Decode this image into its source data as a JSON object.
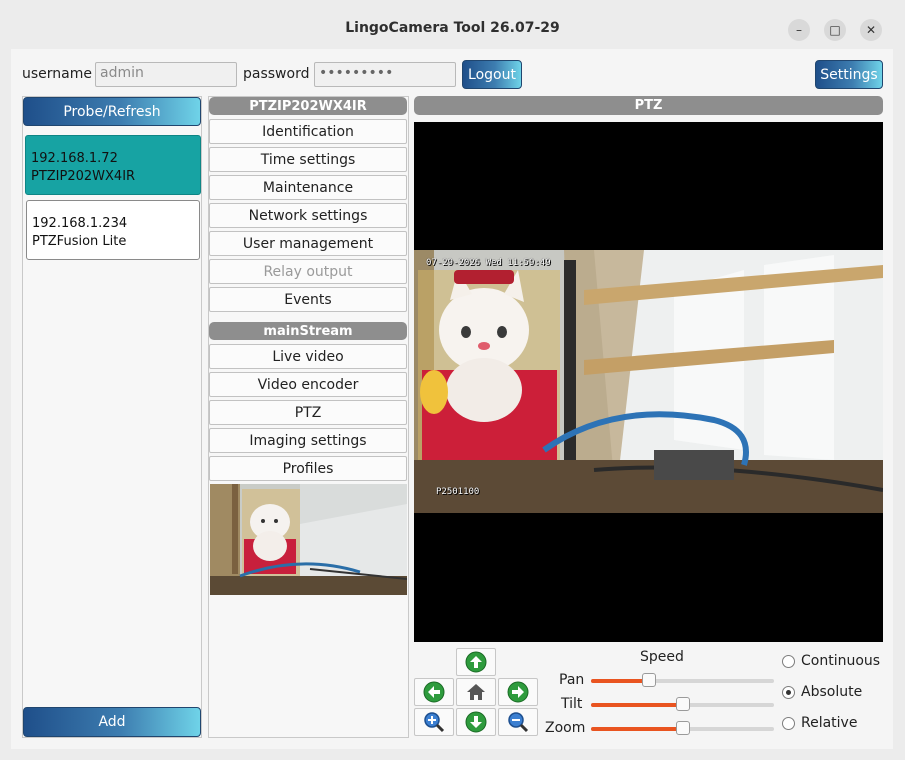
{
  "window": {
    "title": "LingoCamera Tool 26.07-29",
    "minimize_glyph": "–",
    "maximize_glyph": "□",
    "close_glyph": "✕"
  },
  "login": {
    "username_label": "username",
    "username_value": "admin",
    "password_label": "password",
    "password_value": "•••••••••",
    "logout_label": "Logout",
    "settings_label": "Settings"
  },
  "devices": {
    "probe_label": "Probe/Refresh",
    "add_label": "Add",
    "items": [
      {
        "ip": "192.168.1.72",
        "model": "PTZIP202WX4IR",
        "selected": true
      },
      {
        "ip": "192.168.1.234",
        "model": "PTZFusion Lite",
        "selected": false
      }
    ]
  },
  "menu": {
    "device_header": "PTZIP202WX4IR",
    "device_items": [
      {
        "label": "Identification",
        "enabled": true
      },
      {
        "label": "Time settings",
        "enabled": true
      },
      {
        "label": "Maintenance",
        "enabled": true
      },
      {
        "label": "Network settings",
        "enabled": true
      },
      {
        "label": "User management",
        "enabled": true
      },
      {
        "label": "Relay output",
        "enabled": false
      },
      {
        "label": "Events",
        "enabled": true
      }
    ],
    "stream_header": "mainStream",
    "stream_items": [
      {
        "label": "Live video",
        "enabled": true
      },
      {
        "label": "Video encoder",
        "enabled": true
      },
      {
        "label": "PTZ",
        "enabled": true
      },
      {
        "label": "Imaging settings",
        "enabled": true
      },
      {
        "label": "Profiles",
        "enabled": true
      }
    ]
  },
  "ptz": {
    "header": "PTZ",
    "osd_time": "07-29-2026 Wed 11:59:49",
    "osd_name": "P2501100",
    "speed_label": "Speed",
    "pan_label": "Pan",
    "tilt_label": "Tilt",
    "zoom_label": "Zoom",
    "pan_fraction": 0.3,
    "tilt_fraction": 0.5,
    "zoom_fraction": 0.5,
    "modes": [
      {
        "label": "Continuous",
        "checked": false
      },
      {
        "label": "Absolute",
        "checked": true
      },
      {
        "label": "Relative",
        "checked": false
      }
    ],
    "icons": [
      "up-arrow-icon",
      "left-arrow-icon",
      "home-icon",
      "right-arrow-icon",
      "zoom-in-icon",
      "down-arrow-icon",
      "zoom-out-icon"
    ]
  }
}
